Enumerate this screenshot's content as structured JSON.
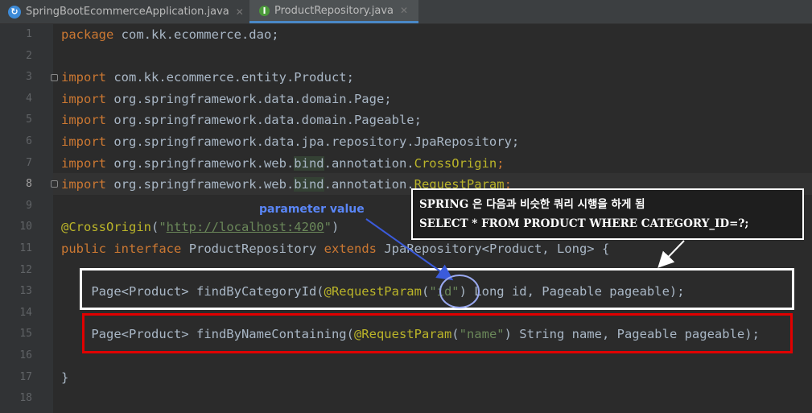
{
  "tabs": [
    {
      "label": "SpringBootEcommerceApplication.java",
      "icon": "spring-boot-icon"
    },
    {
      "label": "ProductRepository.java",
      "icon": "repository-interface-icon",
      "active": true
    }
  ],
  "editor": {
    "current_line": 8,
    "line_numbers": [
      "1",
      "2",
      "3",
      "4",
      "5",
      "6",
      "7",
      "8",
      "9",
      "10",
      "11",
      "12",
      "13",
      "14",
      "15",
      "16",
      "17",
      "18"
    ]
  },
  "code": {
    "l1_kw": "package",
    "l1_rest": " com.kk.ecommerce.dao;",
    "l3_kw": "import",
    "l3_rest": " com.kk.ecommerce.entity.Product;",
    "l4_kw": "import",
    "l4_rest": " org.springframework.data.domain.Page;",
    "l5_kw": "import",
    "l5_rest": " org.springframework.data.domain.Pageable;",
    "l6_kw": "import",
    "l6_rest": " org.springframework.data.jpa.repository.JpaRepository;",
    "l7_kw": "import",
    "l7_a": " org.springframework.web.",
    "l7_b": "bind",
    "l7_c": ".annotation.",
    "l7_d": "CrossOrigin",
    "l7_e": ";",
    "l8_kw": "import",
    "l8_a": " org.springframework.web.",
    "l8_b": "bind",
    "l8_c": ".annotation.",
    "l8_d": "RequestParam",
    "l8_e": ";",
    "l10_ann": "@CrossOrigin",
    "l10_p1": "(",
    "l10_q1": "\"",
    "l10_url": "http://localhost:4200",
    "l10_q2": "\"",
    "l10_p2": ")",
    "l11_kw1": "public",
    "l11_kw2": "interface",
    "l11_name": "ProductRepository",
    "l11_kw3": "extends",
    "l11_rest": " JpaRepository<Product, Long> {",
    "l13_a": "Page<Product> ",
    "l13_m": "findByCategoryId",
    "l13_p": "(",
    "l13_ann": "@RequestParam",
    "l13_p2": "(",
    "l13_str": "\"id\"",
    "l13_rest": ") Long id, Pageable pageable);",
    "l15_a": "Page<Product> ",
    "l15_m": "findByNameContaining",
    "l15_p": "(",
    "l15_ann": "@RequestParam",
    "l15_p2": "(",
    "l15_str": "\"name\"",
    "l15_rest": ") String name, Pageable pageable);",
    "l17": "}"
  },
  "annotations": {
    "param_label": "parameter value",
    "callout_line1": "SPRING 은 다음과 비슷한 쿼리 시행을 하게 됨",
    "callout_line2": "SELECT * FROM PRODUCT WHERE CATEGORY_ID=?;"
  },
  "colors": {
    "background": "#2b2b2b",
    "keyword": "#cc7832",
    "annotation": "#bbb529",
    "string": "#6a8759",
    "text": "#a9b7c6",
    "white_box": "#ffffff",
    "red_box": "#e00000",
    "param_label": "#5a86f7"
  }
}
